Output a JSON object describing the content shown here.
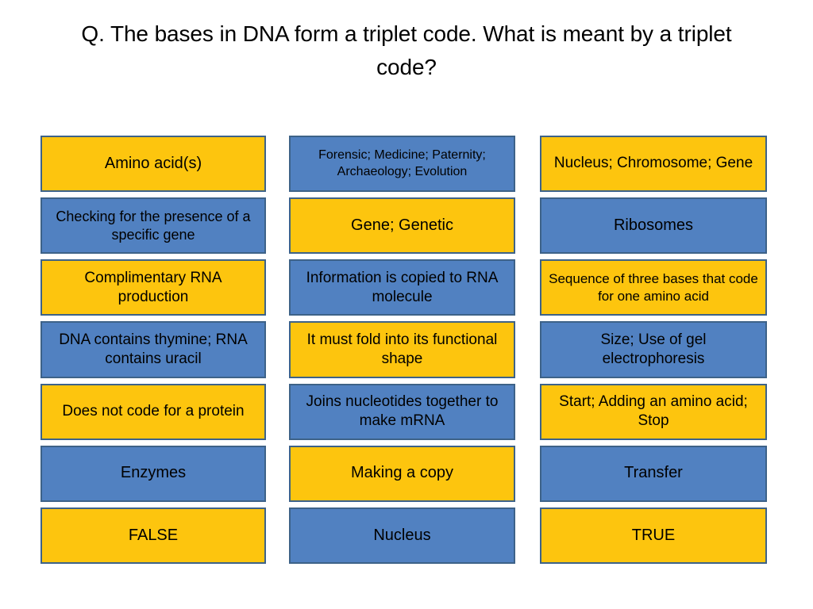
{
  "slide": {
    "title": "Q. The bases in DNA form a triplet code. What is meant by a triplet code?",
    "background_color": "#ffffff",
    "colors": {
      "yellow_fill": "#FDC50E",
      "blue_fill": "#5181C1",
      "border": "#3d6288",
      "text": "#000000"
    }
  },
  "columns": [
    {
      "name": "column-1",
      "cards": [
        {
          "label": "Amino acid(s)",
          "fill": "yellow",
          "size": "lg"
        },
        {
          "label": "Checking for the presence of a specific gene",
          "fill": "blue",
          "size": "sm"
        },
        {
          "label": "Complimentary RNA production",
          "fill": "yellow",
          "size": "md"
        },
        {
          "label": "DNA contains thymine; RNA contains uracil",
          "fill": "blue",
          "size": "md"
        },
        {
          "label": "Does not code for a protein",
          "fill": "yellow",
          "size": "md"
        },
        {
          "label": "Enzymes",
          "fill": "blue",
          "size": "lg"
        },
        {
          "label": "FALSE",
          "fill": "yellow",
          "size": "lg"
        }
      ]
    },
    {
      "name": "column-2",
      "cards": [
        {
          "label": "Forensic; Medicine; Paternity; Archaeology; Evolution",
          "fill": "blue",
          "size": "xxs"
        },
        {
          "label": "Gene; Genetic",
          "fill": "yellow",
          "size": "lg"
        },
        {
          "label": "Information is copied to RNA molecule",
          "fill": "blue",
          "size": "md"
        },
        {
          "label": "It must fold into its functional shape",
          "fill": "yellow",
          "size": "md"
        },
        {
          "label": "Joins nucleotides together to make mRNA",
          "fill": "blue",
          "size": "md"
        },
        {
          "label": "Making a copy",
          "fill": "yellow",
          "size": "lg"
        },
        {
          "label": "Nucleus",
          "fill": "blue",
          "size": "lg"
        }
      ]
    },
    {
      "name": "column-3",
      "cards": [
        {
          "label": "Nucleus; Chromosome; Gene",
          "fill": "yellow",
          "size": "md"
        },
        {
          "label": "Ribosomes",
          "fill": "blue",
          "size": "lg"
        },
        {
          "label": "Sequence of three bases that code for one amino acid",
          "fill": "yellow",
          "size": "xs"
        },
        {
          "label": "Size; Use of gel electrophoresis",
          "fill": "blue",
          "size": "md"
        },
        {
          "label": "Start; Adding an amino acid; Stop",
          "fill": "yellow",
          "size": "md"
        },
        {
          "label": "Transfer",
          "fill": "blue",
          "size": "lg"
        },
        {
          "label": "TRUE",
          "fill": "yellow",
          "size": "lg"
        }
      ]
    }
  ]
}
